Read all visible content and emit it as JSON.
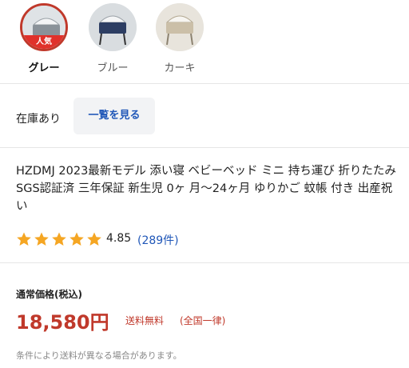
{
  "variants": [
    {
      "label": "グレー",
      "badge": "人気",
      "color": "#8a9299",
      "selected": true
    },
    {
      "label": "ブルー",
      "color": "#2d3e63",
      "selected": false
    },
    {
      "label": "カーキ",
      "color": "#cbbfa8",
      "selected": false
    }
  ],
  "stock": {
    "status": "在庫あり",
    "see_all_label": "一覧を見る"
  },
  "product": {
    "title": "HZDMJ 2023最新モデル 添い寝 ベビーベッド ミニ 持ち運び 折りたたみ SGS認証済 三年保証 新生児 0ヶ 月〜24ヶ月 ゆりかご 蚊帳 付き 出産祝い"
  },
  "rating": {
    "stars": 5,
    "value": "4.85",
    "count_text": "(289件)"
  },
  "price": {
    "label": "通常価格(税込)",
    "amount": "18,580円",
    "shipping": "送料無料",
    "shipping_note": "(全国一律)",
    "condition_note": "条件により送料が異なる場合があります。"
  },
  "colors": {
    "accent_red": "#c0392b",
    "link_blue": "#2057b8",
    "star_gold": "#f5a623"
  }
}
